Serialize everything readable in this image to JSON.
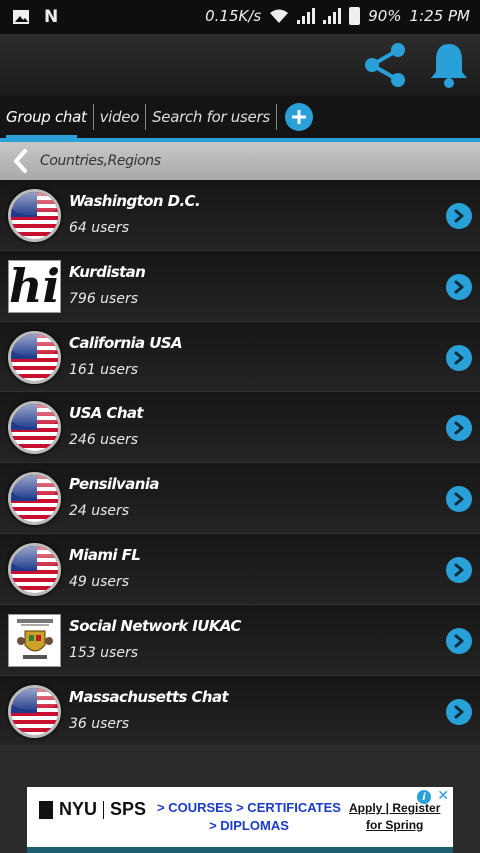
{
  "status_bar": {
    "net_speed": "0.15K/s",
    "battery": "90%",
    "time": "1:25 PM",
    "left_icons": [
      "image-icon",
      "n-icon"
    ]
  },
  "app_bar": {
    "actions": [
      "share-icon",
      "bell-icon"
    ],
    "accent": "#2aa0d9"
  },
  "tabs": [
    {
      "label": "Group chat",
      "active": true
    },
    {
      "label": "video",
      "active": false
    },
    {
      "label": "Search for users",
      "active": false
    }
  ],
  "breadcrumb": {
    "label": "Countries,Regions"
  },
  "rooms": [
    {
      "name": "Washington D.C.",
      "users": "64 users",
      "avatar": "us-flag"
    },
    {
      "name": "Kurdistan",
      "users": "796 users",
      "avatar": "hi-logo"
    },
    {
      "name": "California USA",
      "users": "161 users",
      "avatar": "us-flag"
    },
    {
      "name": "USA Chat",
      "users": "246 users",
      "avatar": "us-flag"
    },
    {
      "name": "Pensilvania",
      "users": "24 users",
      "avatar": "us-flag"
    },
    {
      "name": "Miami FL",
      "users": "49 users",
      "avatar": "us-flag"
    },
    {
      "name": "Social Network IUKAC",
      "users": "153 users",
      "avatar": "crest"
    },
    {
      "name": "Massachusetts Chat",
      "users": "36 users",
      "avatar": "us-flag"
    }
  ],
  "ad": {
    "brand_left": "NYU",
    "brand_right": "SPS",
    "line1": "> COURSES > CERTIFICATES",
    "line2": "> DIPLOMAS",
    "cta1": "Apply | Register",
    "cta2": "for Spring",
    "info": "i",
    "close": "✕",
    "hi_text": "hi"
  }
}
